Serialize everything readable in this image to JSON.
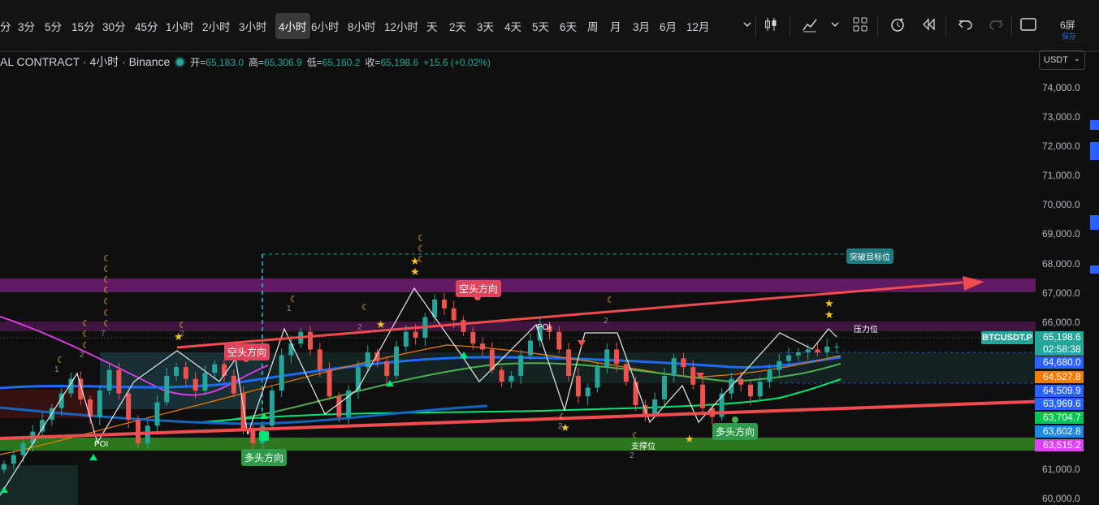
{
  "toolbar": {
    "timeframes": [
      "分",
      "3分",
      "5分",
      "15分",
      "30分",
      "45分",
      "1小时",
      "2小时",
      "3小时",
      "4小时",
      "6小时",
      "8小时",
      "12小时",
      "天",
      "2天",
      "3天",
      "4天",
      "5天",
      "6天",
      "周",
      "月",
      "3月",
      "6月",
      "12月"
    ],
    "active_timeframe": "4小时",
    "layout_label": "6屏",
    "save_label": "保存"
  },
  "legend": {
    "title": "AL CONTRACT · 4小时 · Binance",
    "open_label": "开=",
    "open": "65,183.0",
    "high_label": "高=",
    "high": "65,306.9",
    "low_label": "低=",
    "low": "65,160.2",
    "close_label": "收=",
    "close": "65,198.6",
    "change": "+15.6 (+0.02%)"
  },
  "currency": {
    "label": "USDT",
    "chevron": "⌄"
  },
  "price_axis": {
    "ticks": [
      "74,000.0",
      "73,000.0",
      "72,000.0",
      "71,000.0",
      "70,000.0",
      "69,000.0",
      "68,000.0",
      "67,000.0",
      "66,000.0",
      "61,000.0",
      "60,000.0"
    ],
    "symbol": "BTCUSDT.P",
    "last_price": "65,198.6",
    "countdown": "02:58:38",
    "tags": [
      {
        "text": "64,680.0",
        "color": "#2962ff"
      },
      {
        "text": "64,527.8",
        "color": "#f57c00"
      },
      {
        "text": "64,509.9",
        "color": "#2962ff"
      },
      {
        "text": "63,969.6",
        "color": "#2962ff"
      },
      {
        "text": "63,704.7",
        "color": "#00c853"
      },
      {
        "text": "63,602.8",
        "color": "#1e88e5"
      },
      {
        "text": "63,515.2",
        "color": "#e040fb"
      }
    ]
  },
  "annotations": {
    "breakout_target": "突破目标位",
    "resistance": "压力位",
    "support": "支撑位",
    "bear_direction_1": "空头方向",
    "bear_direction_2": "空头方向",
    "bull_direction_1": "多头方向",
    "bull_direction_2": "多头方向",
    "poi_1": "POI",
    "poi_2": "POI",
    "numbers": [
      "1",
      "2",
      "7",
      "2",
      "1",
      "2",
      "2",
      "2",
      "2"
    ]
  },
  "colors": {
    "up": "#26a69a",
    "down": "#ef5350",
    "accent_blue": "#2962ff",
    "purple_band": "#6a1b6a",
    "green_band": "#1b7a1b",
    "trend_arrow": "#f04b50"
  },
  "chart_data": {
    "type": "candlestick",
    "symbol": "BTCUSDT.P",
    "interval": "4小时",
    "ylim": [
      59800,
      74600
    ],
    "last": {
      "open": 65183.0,
      "high": 65306.9,
      "low": 65160.2,
      "close": 65198.6
    },
    "closes": [
      61200,
      61500,
      61900,
      62300,
      62700,
      63100,
      63600,
      64100,
      63400,
      62800,
      63700,
      64400,
      63600,
      62700,
      61900,
      62500,
      63300,
      64200,
      64500,
      64100,
      63700,
      64300,
      64600,
      64200,
      63600,
      62400,
      61900,
      62500,
      63700,
      64900,
      65300,
      65700,
      65100,
      64400,
      63500,
      62800,
      63700,
      64500,
      65000,
      64700,
      64200,
      65200,
      65700,
      65500,
      66200,
      66800,
      66500,
      66100,
      65700,
      65300,
      65100,
      64400,
      64000,
      64200,
      64900,
      65400,
      65900,
      65700,
      65100,
      64200,
      63500,
      63800,
      64500,
      65100,
      64600,
      64000,
      63200,
      62900,
      63400,
      64200,
      64800,
      64500,
      63900,
      63100,
      62800,
      63600,
      64100,
      63900,
      63500,
      64000,
      64400,
      64700,
      64900,
      65000,
      65100,
      65000,
      65200,
      65200
    ]
  }
}
